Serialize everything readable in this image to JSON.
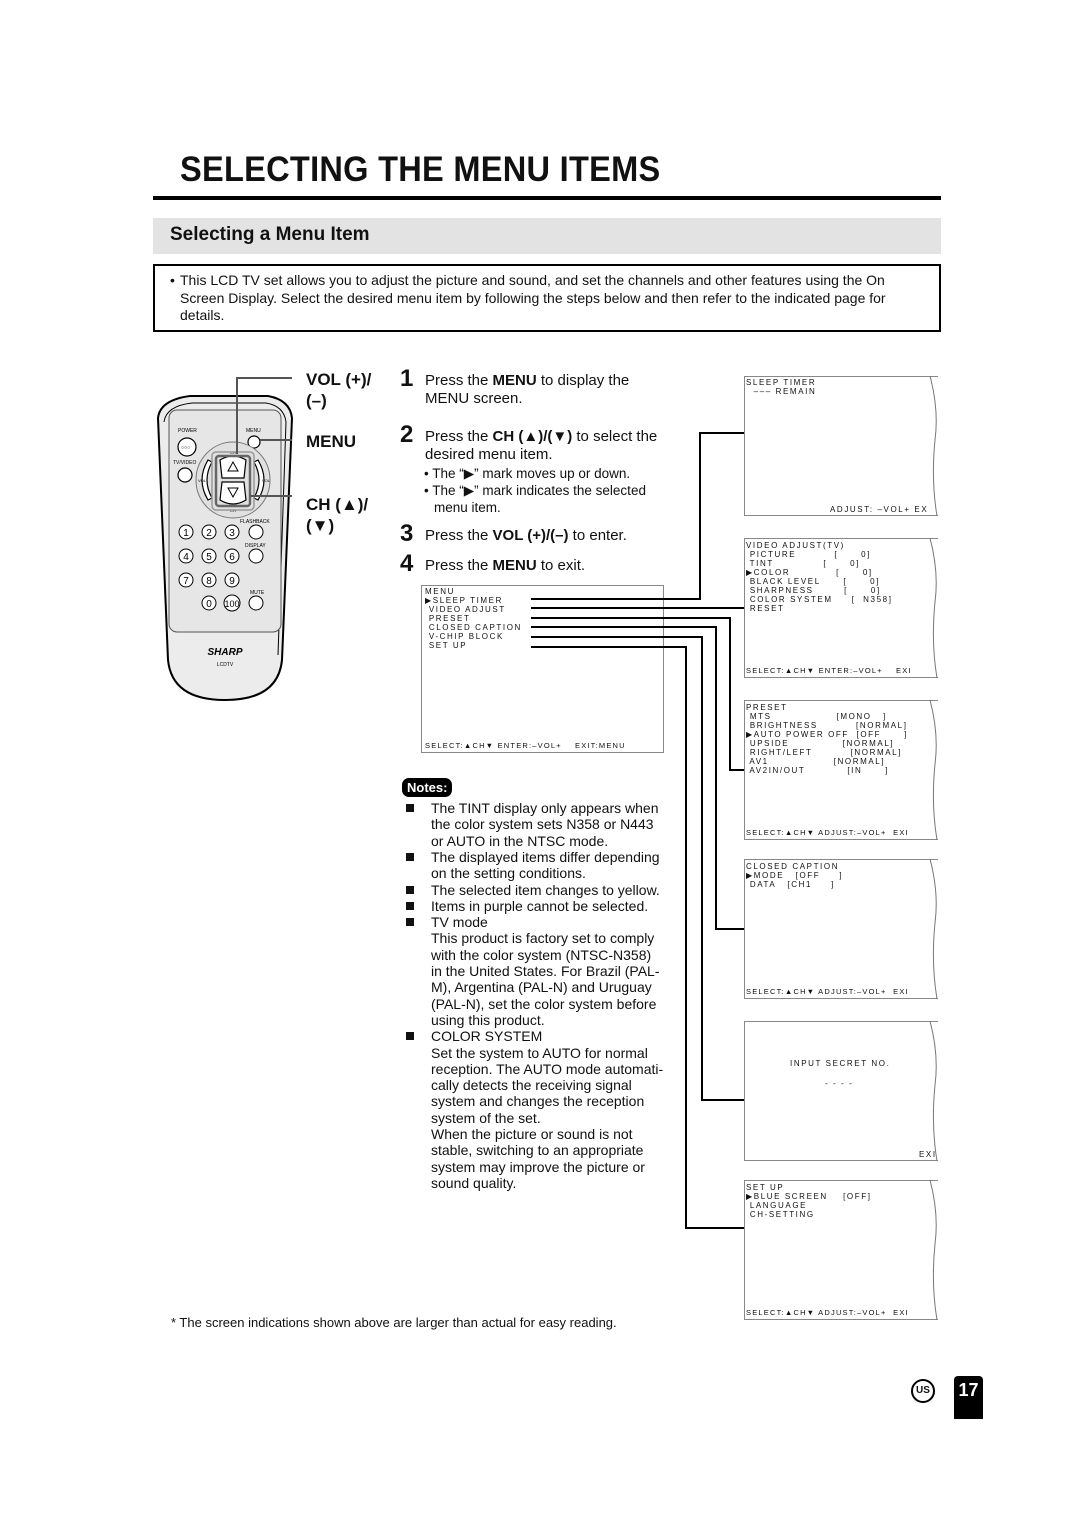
{
  "page_title": "SELECTING THE MENU ITEMS",
  "section_title": "Selecting a Menu Item",
  "intro": {
    "bullet": "•",
    "text": "This LCD TV set allows you to adjust the picture and sound, and set the channels and other features using the On Screen Display. Select the desired menu item by following the steps below and then refer to the indicated page for details."
  },
  "remote": {
    "brand": "SHARP",
    "model": "LCDTV",
    "labels": {
      "power": "POWER",
      "menu": "MENU",
      "tv_video": "TV/VIDEO",
      "vol_minus": "VOL",
      "vol_plus": "VOL",
      "ch_top": "CH",
      "ch_bottom": "CH",
      "flashback": "FLASHBACK",
      "display": "DISPLAY",
      "mute": "MUTE"
    },
    "keys": [
      "1",
      "2",
      "3",
      "4",
      "5",
      "6",
      "7",
      "8",
      "9",
      "0",
      "100"
    ],
    "callouts": {
      "vol_line1": "VOL (+)/",
      "vol_line2": "(–)",
      "menu": "MENU",
      "ch_line1": "CH (▲)/",
      "ch_line2": "(▼)"
    }
  },
  "steps": [
    {
      "num": "1",
      "pre": "Press the ",
      "bold": "MENU",
      "post": " to display the",
      "line2": "MENU screen."
    },
    {
      "num": "2",
      "pre": "Press the ",
      "bold": "CH (▲)/(▼)",
      "post": " to select the",
      "line2": "desired menu item.",
      "bullets": [
        "The “▶” mark moves up or down.",
        "The “▶” mark indicates the selected",
        "menu item."
      ]
    },
    {
      "num": "3",
      "pre": "Press the ",
      "bold": "VOL (+)/(–)",
      "post": " to enter."
    },
    {
      "num": "4",
      "pre": "Press the ",
      "bold": "MENU",
      "post": " to exit."
    }
  ],
  "main_menu": {
    "title": "MENU",
    "items": [
      "▶SLEEP TIMER",
      " VIDEO ADJUST",
      " PRESET",
      " CLOSED CAPTION",
      " V-CHIP BLOCK",
      " SET UP"
    ],
    "footer": "SELECT:▲CH▼ ENTER:–VOL+    EXIT:MENU"
  },
  "screens": {
    "sleep_timer": {
      "lines": [
        "SLEEP TIMER",
        "  ––– REMAIN"
      ],
      "footer": "ADJUST: –VOL+ EX"
    },
    "video_adjust": {
      "lines": [
        "VIDEO ADJUST(TV)",
        " PICTURE          [      0]",
        " TINT             [      0]",
        "▶COLOR            [      0]",
        " BLACK LEVEL      [      0]",
        " SHARPNESS        [      0]",
        " COLOR SYSTEM     [  N358]",
        " RESET"
      ],
      "footer": "SELECT:▲CH▼ ENTER:–VOL+    EXI"
    },
    "preset": {
      "lines": [
        "PRESET",
        " MTS                 [MONO   ]",
        " BRIGHTNESS          [NORMAL]",
        "▶AUTO POWER OFF  [OFF      ]",
        " UPSIDE              [NORMAL]",
        " RIGHT/LEFT          [NORMAL]",
        " AV1                 [NORMAL]",
        " AV2IN/OUT           [IN      ]"
      ],
      "footer": "SELECT:▲CH▼ ADJUST:–VOL+  EXI"
    },
    "closed_caption": {
      "lines": [
        "CLOSED CAPTION",
        "▶MODE   [OFF     ]",
        " DATA   [CH1     ]"
      ],
      "footer": "SELECT:▲CH▼ ADJUST:–VOL+  EXI"
    },
    "vchip": {
      "prompt": "INPUT SECRET NO.",
      "input": "- - - -",
      "footer": "EXI"
    },
    "setup": {
      "lines": [
        "SET UP",
        "▶BLUE SCREEN    [OFF]",
        " LANGUAGE",
        " CH-SETTING"
      ],
      "footer": "SELECT:▲CH▼ ADJUST:–VOL+  EXI"
    }
  },
  "notes": {
    "label": "Notes:",
    "items": [
      [
        "The TINT display only appears when",
        "the color system sets N358 or N443",
        "or AUTO in the NTSC mode."
      ],
      [
        "The displayed items differ depending",
        "on the setting conditions."
      ],
      [
        "The selected item changes to yellow."
      ],
      [
        "Items in purple cannot be selected."
      ],
      [
        "TV mode",
        "This product is factory set to comply",
        "with the color system (NTSC-N358)",
        "in the United States. For Brazil (PAL-",
        "M), Argentina (PAL-N) and Uruguay",
        "(PAL-N), set the color system before",
        "using this product."
      ],
      [
        "COLOR SYSTEM",
        "Set the system to AUTO for normal",
        "reception. The AUTO mode automati-",
        "cally detects the receiving signal",
        "system and changes the reception",
        "system of the set.",
        "When the picture or sound is not",
        "stable, switching to an appropriate",
        "system may improve the picture or",
        "sound quality."
      ]
    ]
  },
  "footnote": "* The screen indications shown above are larger than actual for easy reading.",
  "region_badge": "US",
  "page_number": "17"
}
